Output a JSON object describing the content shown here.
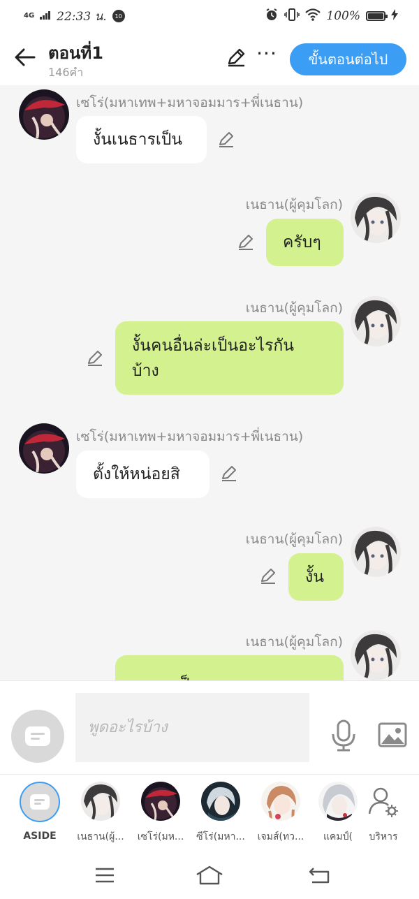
{
  "status_bar": {
    "network": "4G",
    "time": "22:33 น.",
    "notification": "10",
    "battery": "100%"
  },
  "header": {
    "title": "ตอนที่1",
    "word_count": "146คำ",
    "next_button": "ขั้นตอนต่อไป",
    "icons": [
      "back-arrow-icon",
      "pen-icon",
      "more-icon"
    ]
  },
  "messages": [
    {
      "side": "left",
      "sender": "เซโร่(มหาเทพ+มหาจอมมาร+พี่เนธาน)",
      "text": "งั้นเนธารเป็น"
    },
    {
      "side": "right",
      "sender": "เนธาน(ผู้คุมโลก)",
      "text": "ครับๆ"
    },
    {
      "side": "right",
      "sender": "เนธาน(ผู้คุมโลก)",
      "text_line1": "งั้นคนอื่นล่ะเป็นอะไรกัน",
      "text_line2": "บ้าง"
    },
    {
      "side": "left",
      "sender": "เซโร่(มหาเทพ+มหาจอมมาร+พี่เนธาน)",
      "text": "ตั้งให้หน่อยสิ"
    },
    {
      "side": "right",
      "sender": "เนธาน(ผู้คุมโลก)",
      "text": "งั้น"
    },
    {
      "side": "right",
      "sender": "เนธาน(ผู้คุมโลก)",
      "text": "ทุกคนเป็น ทวยเทพและ"
    }
  ],
  "input": {
    "placeholder": "พูดอะไรบ้าง",
    "icons": [
      "microphone-icon",
      "image-icon"
    ]
  },
  "characters": [
    {
      "label": "ASIDE"
    },
    {
      "label": "เนธาน(ผู้..."
    },
    {
      "label": "เซโร่(มห..."
    },
    {
      "label": "ซีโร่(มหา..."
    },
    {
      "label": "เจมส์(ทว..."
    },
    {
      "label": "แคมป์("
    },
    {
      "label": "บริหาร"
    }
  ],
  "colors": {
    "accent": "#3b9df3",
    "right_bubble": "#d3f28f",
    "left_bubble": "#ffffff",
    "chat_background": "#f5f5f5"
  }
}
